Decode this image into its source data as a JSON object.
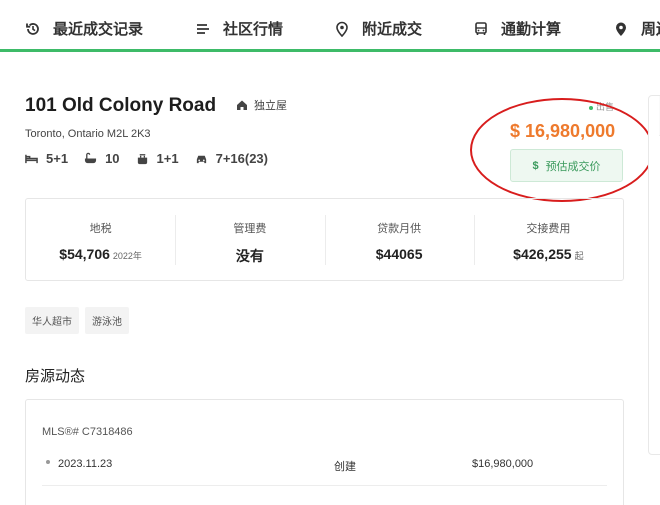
{
  "nav": {
    "items": [
      {
        "label": "最近成交记录",
        "icon": "history-icon"
      },
      {
        "label": "社区行情",
        "icon": "list-icon"
      },
      {
        "label": "附近成交",
        "icon": "location-pin-icon"
      },
      {
        "label": "通勤计算",
        "icon": "bus-icon"
      },
      {
        "label": "周边",
        "icon": "location-pin-icon"
      }
    ],
    "accent_color": "#3dbb68"
  },
  "listing": {
    "title": "101 Old Colony Road",
    "type": "独立屋",
    "address": "Toronto, Ontario M2L 2K3",
    "specs": {
      "bedrooms": "5+1",
      "bathrooms": "10",
      "kitchens": "1+1",
      "parking": "7+16(23)"
    },
    "status": "出售",
    "price": "$ 16,980,000",
    "price_color": "#ee7a2d",
    "estimate_dollar": "$",
    "estimate_label": "预估成交价"
  },
  "stats": [
    {
      "label": "地税",
      "value": "$54,706",
      "suffix": "2022年"
    },
    {
      "label": "管理费",
      "value": "没有",
      "suffix": ""
    },
    {
      "label": "贷款月供",
      "value": "$44065",
      "suffix": ""
    },
    {
      "label": "交接费用",
      "value": "$426,255",
      "suffix": "起"
    }
  ],
  "tags": [
    "华人超市",
    "游泳池"
  ],
  "history": {
    "section_title": "房源动态",
    "mls": "MLS®# C7318486",
    "rows": [
      {
        "date": "2023.11.23",
        "event": "创建",
        "amount": "$16,980,000"
      }
    ]
  }
}
